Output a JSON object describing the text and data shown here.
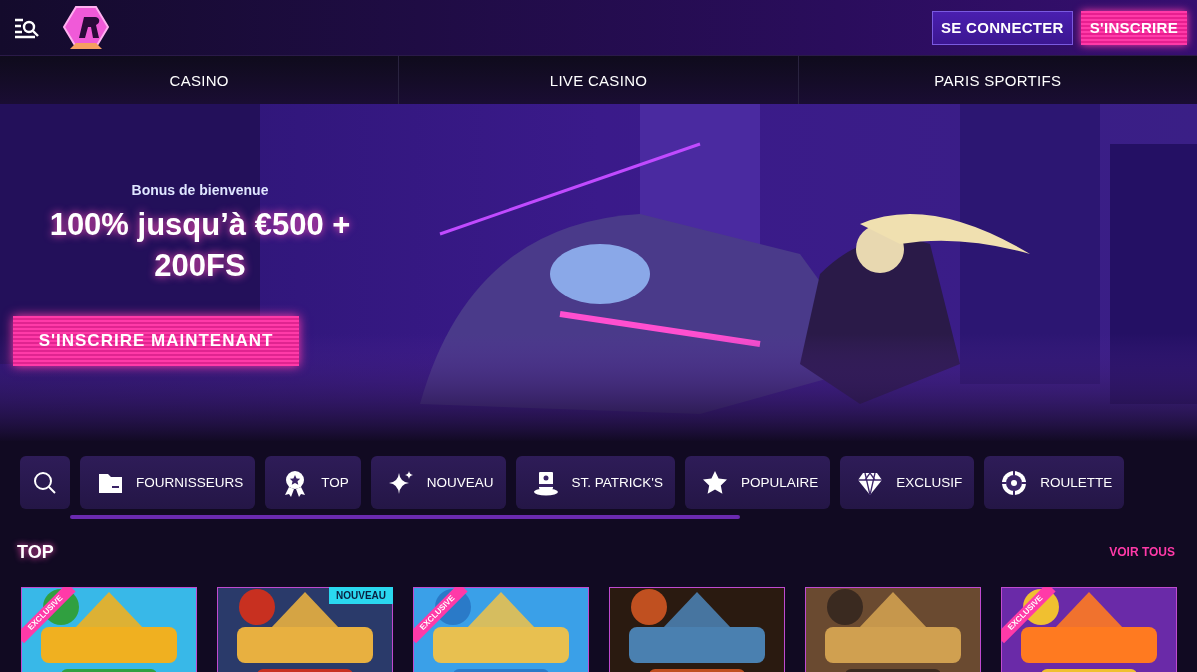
{
  "header": {
    "login_button": "SE CONNECTER",
    "register_button": "S'INSCRIRE"
  },
  "nav": [
    "CASINO",
    "LIVE CASINO",
    "PARIS SPORTIFS"
  ],
  "hero": {
    "kind": "picture",
    "subtitle": "Bonus de bienvenue",
    "headline": "100% jusqu’à €500 + 200FS",
    "cta": "S'INSCRIRE MAINTENANT"
  },
  "categories": [
    "FOURNISSEURS",
    "TOP",
    "NOUVEAU",
    "ST. PATRICK'S",
    "POPULAIRE",
    "EXCLUSIF",
    "ROULETTE"
  ],
  "section": {
    "title": "TOP",
    "link": "VOIR TOUS"
  },
  "games": [
    {
      "kind": "picture",
      "badge": {
        "kind": "ribbon",
        "text": "EXCLUSIVE"
      }
    },
    {
      "kind": "picture",
      "badge": {
        "kind": "tag",
        "text": "NOUVEAU"
      }
    },
    {
      "kind": "picture",
      "badge": {
        "kind": "ribbon",
        "text": "EXCLUSIVE"
      }
    },
    {
      "kind": "picture"
    },
    {
      "kind": "picture"
    },
    {
      "kind": "picture",
      "badge": {
        "kind": "ribbon",
        "text": "EXCLUSIVE"
      }
    }
  ]
}
